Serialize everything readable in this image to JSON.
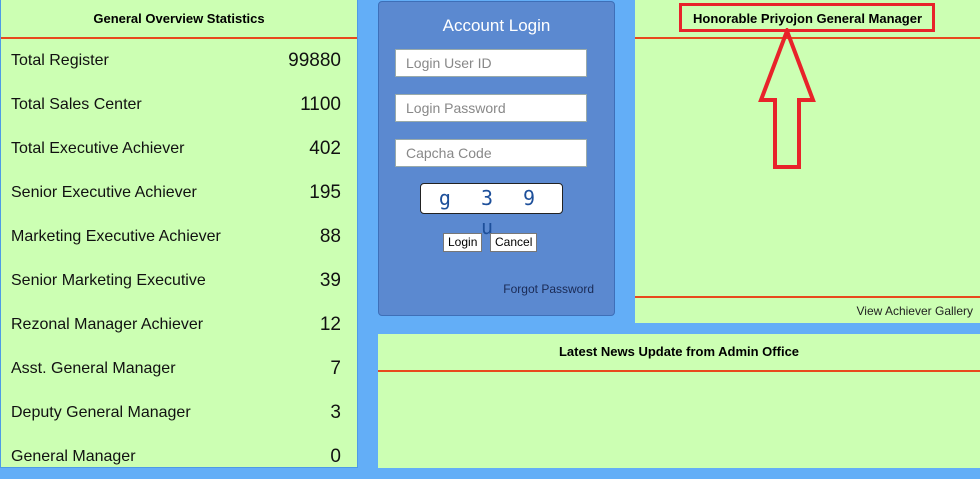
{
  "stats": {
    "title": "General Overview Statistics",
    "rows": [
      {
        "label": "Total Register",
        "value": "99880"
      },
      {
        "label": "Total Sales Center",
        "value": "1100"
      },
      {
        "label": "Total Executive Achiever",
        "value": "402"
      },
      {
        "label": "Senior Executive Achiever",
        "value": "195"
      },
      {
        "label": "Marketing Executive Achiever",
        "value": "88"
      },
      {
        "label": "Senior Marketing Executive",
        "value": "39"
      },
      {
        "label": "Rezonal Manager Achiever",
        "value": "12"
      },
      {
        "label": "Asst. General Manager",
        "value": "7"
      },
      {
        "label": "Deputy General Manager",
        "value": "3"
      },
      {
        "label": "General Manager",
        "value": "0"
      }
    ]
  },
  "login": {
    "title": "Account Login",
    "user_placeholder": "Login User ID",
    "password_placeholder": "Login Password",
    "captcha_placeholder": "Capcha Code",
    "captcha_text": "g 3 9 u",
    "login_label": "Login",
    "cancel_label": "Cancel",
    "forgot_label": "Forgot Password"
  },
  "manager": {
    "title": "Honorable Priyojon General Manager",
    "gallery_link": "View Achiever Gallery"
  },
  "news": {
    "title": "Latest News Update from Admin Office"
  },
  "colors": {
    "panel_bg": "#ccffb3",
    "page_bg": "#63aef7",
    "divider": "#e8491d",
    "login_bg": "#5b89d0",
    "annotation_red": "#e8232a"
  }
}
